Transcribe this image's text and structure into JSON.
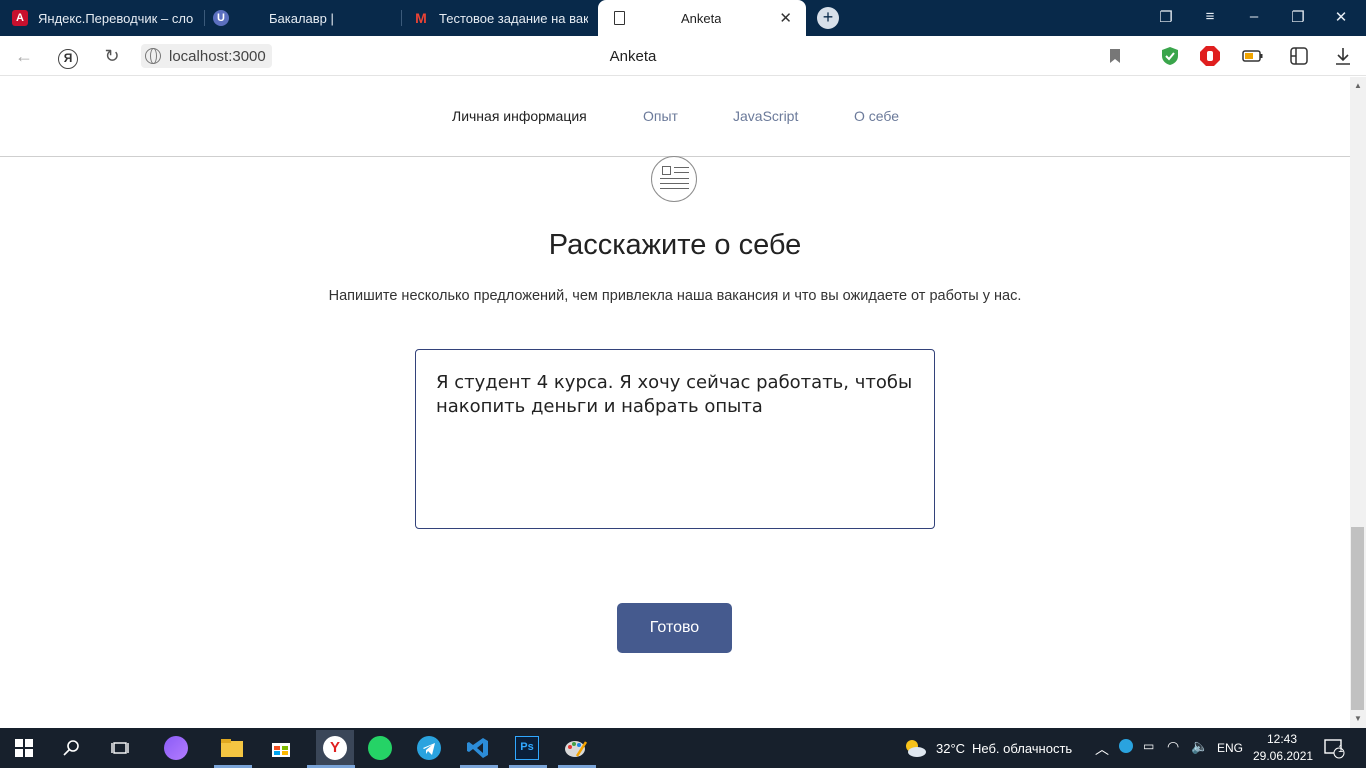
{
  "browser": {
    "tabs": [
      {
        "title": "Яндекс.Переводчик – сло",
        "favicon": "translate-icon"
      },
      {
        "title": "Бакалавр |",
        "favicon": "u-icon"
      },
      {
        "title": "Тестовое задание на вака",
        "favicon": "gmail-icon"
      },
      {
        "title": "Anketa",
        "favicon": "page-icon",
        "active": true
      }
    ],
    "new_tab_label": "+",
    "address": "localhost:3000",
    "page_title": "Anketa"
  },
  "page": {
    "nav": [
      "Личная информация",
      "Опыт",
      "JavaScript",
      "О себе"
    ],
    "heading": "Расскажите о себе",
    "subtext": "Напишите несколько предложений, чем привлекла наша вакансия и что вы ожидаете от работы у нас.",
    "textarea_value": "Я студент 4 курса. Я хочу сейчас работать, чтобы накопить деньги и набрать опыта",
    "submit_label": "Готово"
  },
  "taskbar": {
    "weather_temp": "32°C",
    "weather_text": "Неб. облачность",
    "language": "ENG",
    "time": "12:43",
    "date": "29.06.2021",
    "notifications": "1"
  },
  "colors": {
    "tabstrip": "#08294a",
    "primary_button": "#455a8e",
    "nav_link": "#6b7a9a",
    "taskbar": "#17202c"
  }
}
